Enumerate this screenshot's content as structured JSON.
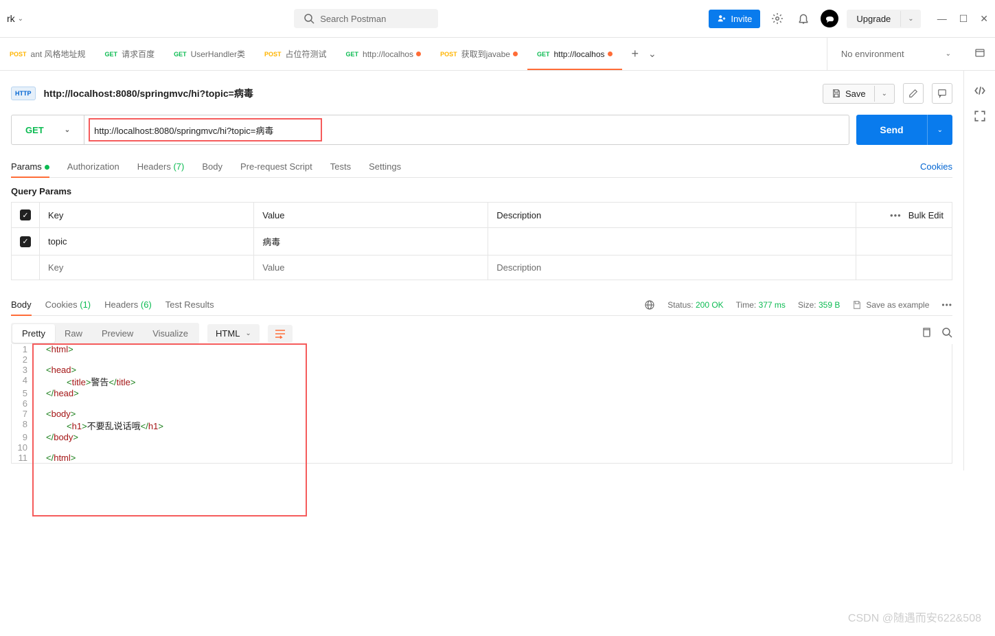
{
  "topbar": {
    "workspace": "rk",
    "search_placeholder": "Search Postman",
    "invite": "Invite",
    "upgrade": "Upgrade"
  },
  "tabs": [
    {
      "method": "POST",
      "label": "ant 风格地址规"
    },
    {
      "method": "GET",
      "label": "请求百度"
    },
    {
      "method": "GET",
      "label": "UserHandler类"
    },
    {
      "method": "POST",
      "label": "占位符测试"
    },
    {
      "method": "GET",
      "label": "http://localhos",
      "dot": true
    },
    {
      "method": "POST",
      "label": "获取到javabe",
      "dot": true
    },
    {
      "method": "GET",
      "label": "http://localhos",
      "dot": true,
      "active": true
    }
  ],
  "env": {
    "label": "No environment"
  },
  "request": {
    "title": "http://localhost:8080/springmvc/hi?topic=病毒",
    "save": "Save",
    "method": "GET",
    "url": "http://localhost:8080/springmvc/hi?topic=病毒",
    "send": "Send"
  },
  "req_tabs": {
    "params": "Params",
    "auth": "Authorization",
    "headers": "Headers",
    "headers_count": "(7)",
    "body": "Body",
    "prereq": "Pre-request Script",
    "tests": "Tests",
    "settings": "Settings",
    "cookies": "Cookies"
  },
  "query": {
    "title": "Query Params",
    "headers": {
      "key": "Key",
      "value": "Value",
      "desc": "Description",
      "bulk": "Bulk Edit"
    },
    "row": {
      "key": "topic",
      "value": "病毒"
    },
    "placeholder": {
      "key": "Key",
      "value": "Value",
      "desc": "Description"
    }
  },
  "resp_tabs": {
    "body": "Body",
    "cookies": "Cookies",
    "cookies_count": "(1)",
    "headers": "Headers",
    "headers_count": "(6)",
    "tests": "Test Results"
  },
  "resp_meta": {
    "status_lbl": "Status:",
    "status": "200 OK",
    "time_lbl": "Time:",
    "time": "377 ms",
    "size_lbl": "Size:",
    "size": "359 B",
    "save_example": "Save as example"
  },
  "view": {
    "pretty": "Pretty",
    "raw": "Raw",
    "preview": "Preview",
    "visualize": "Visualize",
    "format": "HTML"
  },
  "code": {
    "l1_a": "<",
    "l1_b": "html",
    "l1_c": ">",
    "l3_a": "<",
    "l3_b": "head",
    "l3_c": ">",
    "l4_a": "<",
    "l4_b": "title",
    "l4_c": ">",
    "l4_txt": "警告",
    "l4_d": "</",
    "l4_e": "title",
    "l4_f": ">",
    "l5_a": "</",
    "l5_b": "head",
    "l5_c": ">",
    "l7_a": "<",
    "l7_b": "body",
    "l7_c": ">",
    "l8_a": "<",
    "l8_b": "h1",
    "l8_c": ">",
    "l8_txt": "不要乱说话哦",
    "l8_d": "</",
    "l8_e": "h1",
    "l8_f": ">",
    "l9_a": "</",
    "l9_b": "body",
    "l9_c": ">",
    "l11_a": "</",
    "l11_b": "html",
    "l11_c": ">"
  },
  "gutter": [
    "1",
    "2",
    "3",
    "4",
    "5",
    "6",
    "7",
    "8",
    "9",
    "10",
    "11"
  ],
  "watermark": "CSDN @随遇而安622&508"
}
